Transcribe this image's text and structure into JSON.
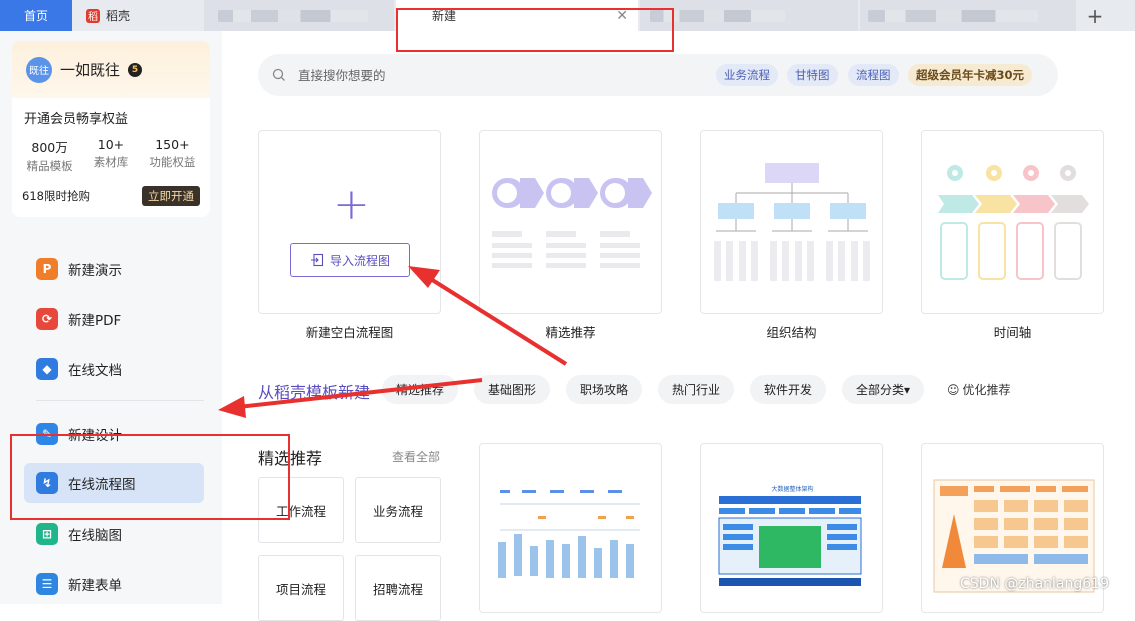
{
  "tabs": {
    "home": "首页",
    "docer": "稻壳",
    "active": "新建",
    "docer_logo": "稻"
  },
  "sidebar": {
    "member": {
      "avatar_text": "既往",
      "name": "一如既往",
      "vip_level": "5",
      "title": "开通会员畅享权益",
      "stats": [
        {
          "value": "800万",
          "label": "精品模板"
        },
        {
          "value": "10+",
          "label": "素材库"
        },
        {
          "value": "150+",
          "label": "功能权益"
        }
      ],
      "promo": "618限时抢购",
      "open_button": "立即开通"
    },
    "items": [
      {
        "label": "新建演示",
        "icon": "presentation-icon",
        "color": "#f07d2a"
      },
      {
        "label": "新建PDF",
        "icon": "pdf-icon",
        "color": "#e6493c"
      },
      {
        "label": "在线文档",
        "icon": "cloud-doc-icon",
        "color": "#2f7be0"
      },
      {
        "label": "新建设计",
        "icon": "design-icon",
        "color": "#2e86e6"
      },
      {
        "label": "在线流程图",
        "icon": "flowchart-icon",
        "color": "#2f7be0"
      },
      {
        "label": "在线脑图",
        "icon": "mindmap-icon",
        "color": "#21b58b"
      },
      {
        "label": "新建表单",
        "icon": "form-icon",
        "color": "#2f86e0"
      }
    ]
  },
  "search": {
    "placeholder": "直接搜你想要的",
    "chips": [
      "业务流程",
      "甘特图",
      "流程图"
    ],
    "promo": "超级会员年卡减30元"
  },
  "cards": {
    "blank_label": "新建空白流程图",
    "import_button": "导入流程图",
    "selected": "精选推荐",
    "org": "组织结构",
    "timeline": "时间轴"
  },
  "templates": {
    "section_title": "从稻壳模板新建",
    "categories": [
      "精选推荐",
      "基础图形",
      "职场攻略",
      "热门行业",
      "软件开发",
      "全部分类▾"
    ],
    "optimize": "优化推荐",
    "featured_title": "精选推荐",
    "view_all": "查看全部",
    "mini": [
      "工作流程",
      "业务流程",
      "项目流程",
      "招聘流程"
    ],
    "tpl2_title": "大数据整体架构"
  },
  "watermark": "CSDN @zhanlang619",
  "colors": {
    "accent": "#5a4dc0",
    "annotation": "#e8302f",
    "home_tab": "#3b78e7"
  }
}
